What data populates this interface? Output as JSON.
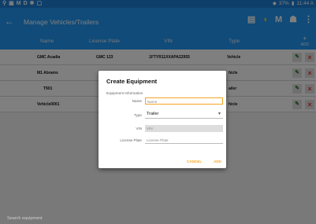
{
  "statusbar": {
    "icons": [
      "location-icon",
      "image-icon",
      "m-icon",
      "d-icon",
      "settings-icon",
      "screenshot-icon"
    ],
    "left_glyphs": [
      "M",
      "D"
    ],
    "battery": "37%",
    "time": "11:44 A"
  },
  "appbar": {
    "title": "Manage Vehicles/Trailers",
    "action_m": "M",
    "accent": "#2196f3"
  },
  "table": {
    "headers": [
      "Name",
      "License Plate",
      "VIN",
      "Type"
    ],
    "add_label": "ADD",
    "rows": [
      {
        "name": "GMC Acadia",
        "plate": "GMC 123",
        "vin": "1FTYR11XXAPA22955",
        "type": "Vehicle"
      },
      {
        "name": "M1 Abrams",
        "plate": "",
        "vin": "",
        "type": "hicle"
      },
      {
        "name": "T901",
        "plate": "",
        "vin": "",
        "type": "ailer"
      },
      {
        "name": "Vehicle0001",
        "plate": "",
        "vin": "",
        "type": "hicle"
      }
    ]
  },
  "search": {
    "placeholder": "Search equipment"
  },
  "dialog": {
    "title": "Create Equipment",
    "section": "Equipment Information",
    "name_label": "Name",
    "name_placeholder": "Name",
    "type_label": "Type",
    "type_value": "Trailer",
    "vin_label": "VIN",
    "vin_placeholder": "VIN",
    "plate_label": "License Plate",
    "plate_placeholder": "License Plate",
    "cancel_label": "CANCEL",
    "add_label": "ADD",
    "button_color": "#f6a623"
  }
}
